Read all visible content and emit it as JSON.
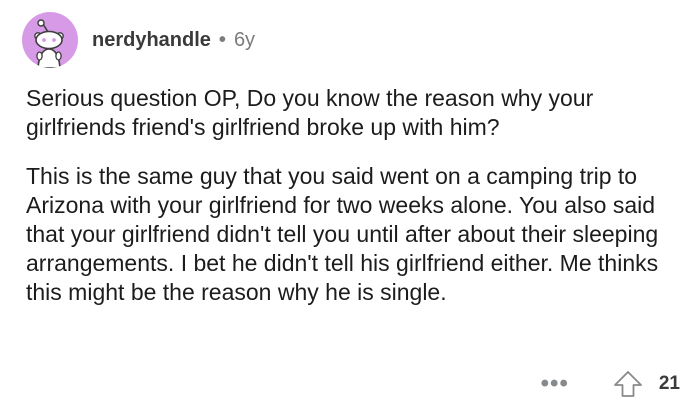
{
  "author": {
    "username": "nerdyhandle",
    "separator": "•",
    "age": "6y",
    "avatar_color": "#d79ae6"
  },
  "comment": {
    "paragraphs": [
      "Serious question OP, Do you know the reason why your girlfriends friend's girlfriend broke up with him?",
      "This is the same guy that you said went on a camping trip to Arizona with your girlfriend for two weeks alone. You also said that your girlfriend didn't tell you until after about their sleeping arrangements. I bet he didn't tell his girlfriend either. Me thinks this might be the reason why he is single."
    ]
  },
  "actions": {
    "more_label": "•••",
    "upvote_icon": "upvote-arrow-icon",
    "score": "21"
  }
}
